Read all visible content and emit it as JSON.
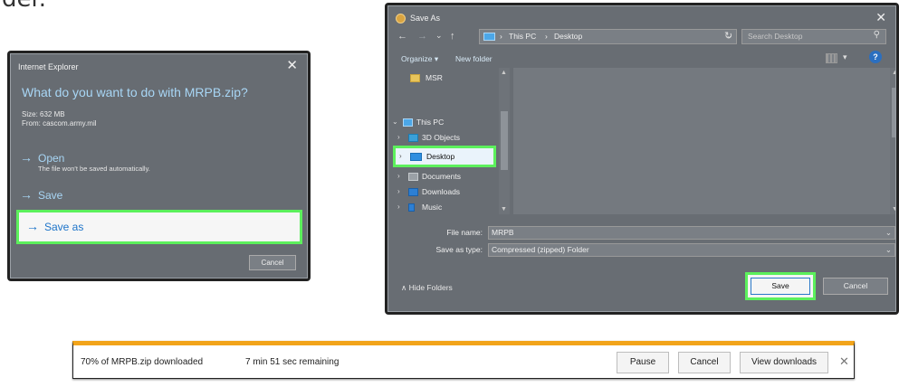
{
  "caption": {
    "text": "der."
  },
  "ie_dialog": {
    "title": "Internet Explorer",
    "close": "✕",
    "question": "What do you want to do with MRPB.zip?",
    "size": "Size: 632 MB",
    "from": "From: cascom.army.mil",
    "arrow": "→",
    "open_label": "Open",
    "open_sub": "The file won't be saved automatically.",
    "save_label": "Save",
    "saveas_label": "Save as",
    "cancel_label": "Cancel"
  },
  "save_as": {
    "title": "Save As",
    "close": "✕",
    "nav": {
      "back": "←",
      "forward": "→",
      "recent": "⌄",
      "up": "↑"
    },
    "address": {
      "seg1": "›",
      "seg2": "This PC",
      "seg3": "›",
      "seg4": "Desktop",
      "drop": "⌄"
    },
    "refresh": "↻",
    "search_placeholder": "Search Desktop",
    "search_icon": "⚲",
    "organize": "Organize ▾",
    "new_folder": "New folder",
    "view_drop": "▾",
    "help": "?",
    "tree": {
      "msr": "MSR",
      "this_pc": "This PC",
      "objects3d": "3D Objects",
      "desktop": "Desktop",
      "documents": "Documents",
      "downloads": "Downloads",
      "music": "Music",
      "chev_open": "⌄",
      "chev_closed": "›"
    },
    "scroll": {
      "up": "▲",
      "down": "▼"
    },
    "file_name_label": "File name:",
    "file_name_value": "MRPB",
    "save_type_label": "Save as type:",
    "save_type_value": "Compressed (zipped) Folder",
    "field_drop": "⌄",
    "hide_folders": "∧  Hide Folders",
    "save_button": "Save",
    "cancel_button": "Cancel"
  },
  "download_bar": {
    "status": "70% of MRPB.zip downloaded",
    "remaining": "7 min 51 sec remaining",
    "pause": "Pause",
    "cancel": "Cancel",
    "view_downloads": "View downloads",
    "close": "✕",
    "accent_color": "#f2a41a"
  }
}
